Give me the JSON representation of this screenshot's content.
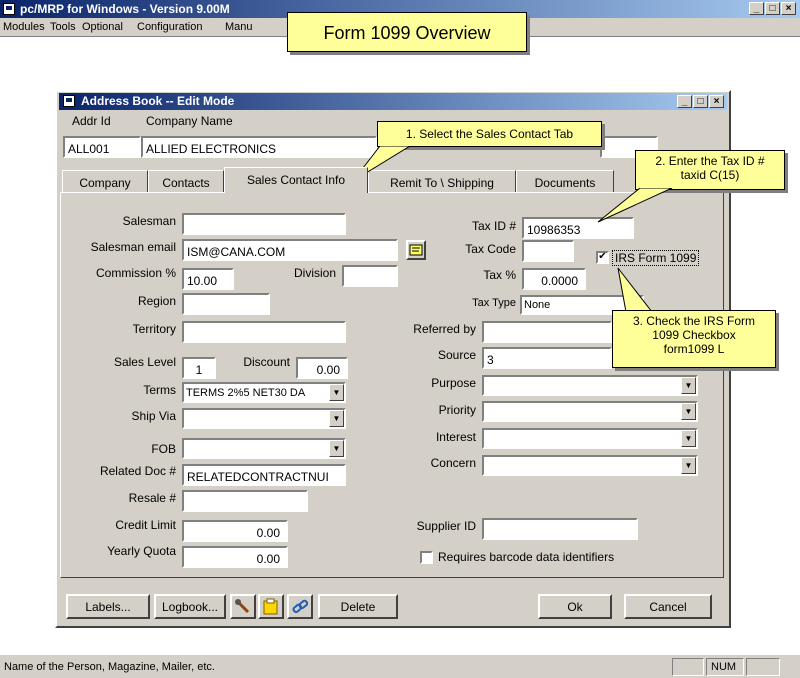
{
  "app": {
    "title": "pc/MRP for Windows - Version 9.00M",
    "menu": [
      "Modules",
      "Tools",
      "Optional",
      "Configuration",
      "Manu"
    ],
    "status_text": "Name of the Person, Magazine, Mailer, etc.",
    "status_num": "NUM"
  },
  "overview_callout": "Form 1099 Overview",
  "dialog": {
    "title": "Address Book -- Edit Mode",
    "addr_id_label": "Addr Id",
    "company_name_label": "Company Name",
    "addr_id": "ALL001",
    "company_name": "ALLIED ELECTRONICS",
    "tabs": [
      "Company",
      "Contacts",
      "Sales Contact Info",
      "Remit To \\ Shipping",
      "Documents"
    ]
  },
  "callouts": {
    "step1": "1. Select the Sales Contact Tab",
    "step2_line1": "2. Enter the Tax ID #",
    "step2_line2": "taxid C(15)",
    "step3_line1": "3. Check the IRS Form",
    "step3_line2": "1099 Checkbox",
    "step3_line3": "form1099 L"
  },
  "left": {
    "salesman_label": "Salesman",
    "salesman": "",
    "salesman_email_label": "Salesman email",
    "salesman_email": "ISM@CANA.COM",
    "commission_label": "Commission %",
    "commission": "10.00",
    "division_label": "Division",
    "division": "",
    "region_label": "Region",
    "region": "",
    "territory_label": "Territory",
    "territory": "",
    "sales_level_label": "Sales Level",
    "sales_level": "1",
    "discount_label": "Discount",
    "discount": "0.00",
    "terms_label": "Terms",
    "terms": "TERMS 2%5 NET30 DA",
    "ship_via_label": "Ship Via",
    "ship_via": "",
    "fob_label": "FOB",
    "fob": "",
    "related_doc_label": "Related Doc #",
    "related_doc": "RELATEDCONTRACTNUI",
    "resale_label": "Resale #",
    "resale": "",
    "credit_limit_label": "Credit Limit",
    "credit_limit": "0.00",
    "yearly_quota_label": "Yearly Quota",
    "yearly_quota": "0.00"
  },
  "right": {
    "tax_id_label": "Tax ID #",
    "tax_id": "10986353",
    "tax_code_label": "Tax Code",
    "tax_code": "",
    "irs_form_label": "IRS Form 1099",
    "irs_form_checked": true,
    "tax_pct_label": "Tax %",
    "tax_pct": "0.0000",
    "tax_type_label": "Tax Type",
    "tax_type": "None",
    "referred_by_label": "Referred by",
    "referred_by": "",
    "source_label": "Source",
    "source": "3",
    "purpose_label": "Purpose",
    "purpose": "",
    "priority_label": "Priority",
    "priority": "",
    "interest_label": "Interest",
    "interest": "",
    "concern_label": "Concern",
    "concern": "",
    "supplier_id_label": "Supplier ID",
    "supplier_id": "",
    "barcode_label": "Requires barcode data identifiers"
  },
  "buttons": {
    "labels": "Labels...",
    "logbook": "Logbook...",
    "delete": "Delete",
    "ok": "Ok",
    "cancel": "Cancel"
  }
}
